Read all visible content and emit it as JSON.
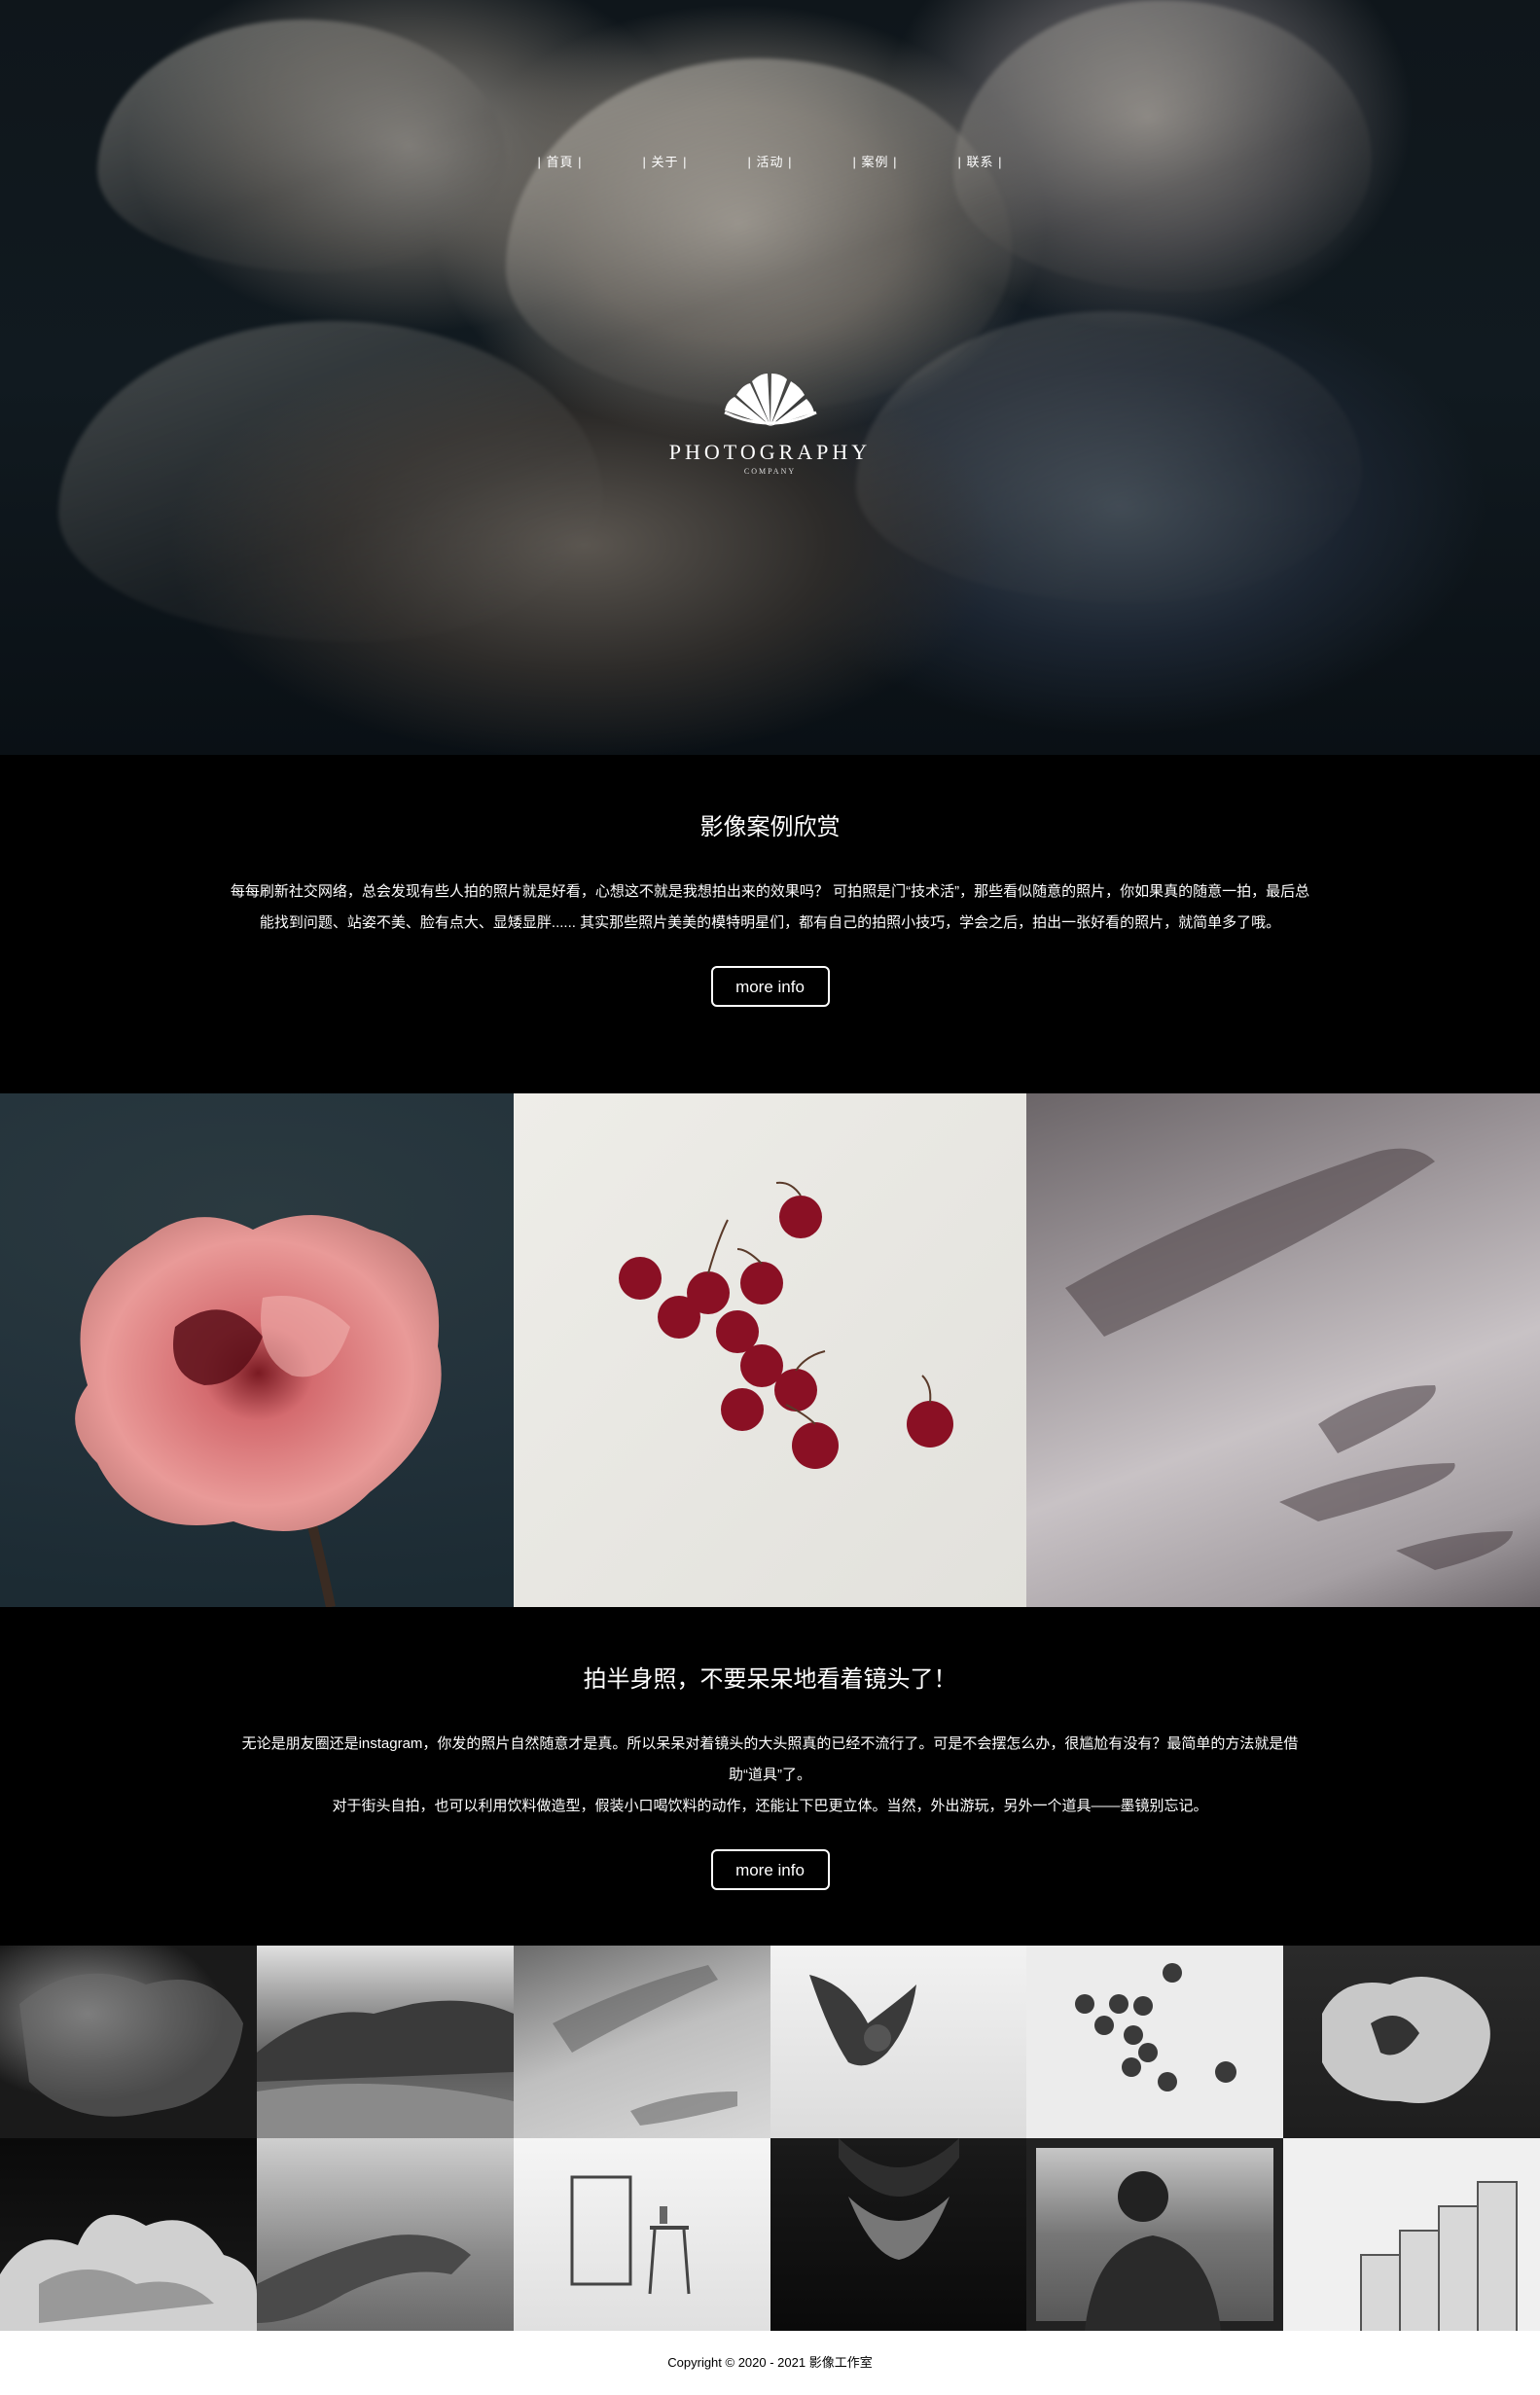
{
  "nav": {
    "items": [
      "| 首頁 |",
      "| 关于 |",
      "| 活动 |",
      "| 案例 |",
      "| 联系 |"
    ]
  },
  "logo": {
    "icon": "shell-fan-icon",
    "brand": "PHOTOGRAPHY",
    "sub": "COMPANY"
  },
  "section1": {
    "title": "影像案例欣赏",
    "text": "每每刷新社交网络，总会发现有些人拍的照片就是好看，心想这不就是我想拍出来的效果吗？ 可拍照是门“技术活”，那些看似随意的照片，你如果真的随意一拍，最后总能找到问题、站姿不美、脸有点大、显矮显胖...... 其实那些照片美美的模特明星们，都有自己的拍照小技巧，学会之后，拍出一张好看的照片，就简单多了哦。",
    "button": "more info"
  },
  "section2": {
    "title": "拍半身照，不要呆呆地看着镜头了！",
    "text1": "无论是朋友圈还是instagram，你发的照片自然随意才是真。所以呆呆对着镜头的大头照真的已经不流行了。可是不会摆怎么办，很尴尬有没有？最简单的方法就是借助“道具”了。",
    "text2": "对于街头自拍，也可以利用饮料做造型，假装小口喝饮料的动作，还能让下巴更立体。当然，外出游玩，另外一个道具——墨镜别忘记。",
    "button": "more info"
  },
  "footer": {
    "text": "Copyright © 2020 - 2021 影像工作室"
  },
  "colors": {
    "background": "#000000",
    "text": "#ffffff",
    "footer_bg": "#ffffff"
  }
}
